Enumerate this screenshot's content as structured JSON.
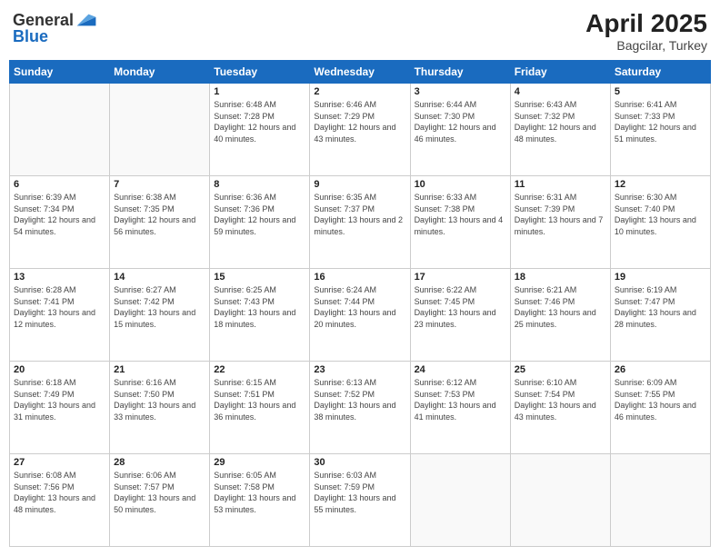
{
  "header": {
    "logo_line1": "General",
    "logo_line2": "Blue",
    "title": "April 2025",
    "subtitle": "Bagcilar, Turkey"
  },
  "weekdays": [
    "Sunday",
    "Monday",
    "Tuesday",
    "Wednesday",
    "Thursday",
    "Friday",
    "Saturday"
  ],
  "weeks": [
    [
      {
        "day": "",
        "info": ""
      },
      {
        "day": "",
        "info": ""
      },
      {
        "day": "1",
        "info": "Sunrise: 6:48 AM\nSunset: 7:28 PM\nDaylight: 12 hours and 40 minutes."
      },
      {
        "day": "2",
        "info": "Sunrise: 6:46 AM\nSunset: 7:29 PM\nDaylight: 12 hours and 43 minutes."
      },
      {
        "day": "3",
        "info": "Sunrise: 6:44 AM\nSunset: 7:30 PM\nDaylight: 12 hours and 46 minutes."
      },
      {
        "day": "4",
        "info": "Sunrise: 6:43 AM\nSunset: 7:32 PM\nDaylight: 12 hours and 48 minutes."
      },
      {
        "day": "5",
        "info": "Sunrise: 6:41 AM\nSunset: 7:33 PM\nDaylight: 12 hours and 51 minutes."
      }
    ],
    [
      {
        "day": "6",
        "info": "Sunrise: 6:39 AM\nSunset: 7:34 PM\nDaylight: 12 hours and 54 minutes."
      },
      {
        "day": "7",
        "info": "Sunrise: 6:38 AM\nSunset: 7:35 PM\nDaylight: 12 hours and 56 minutes."
      },
      {
        "day": "8",
        "info": "Sunrise: 6:36 AM\nSunset: 7:36 PM\nDaylight: 12 hours and 59 minutes."
      },
      {
        "day": "9",
        "info": "Sunrise: 6:35 AM\nSunset: 7:37 PM\nDaylight: 13 hours and 2 minutes."
      },
      {
        "day": "10",
        "info": "Sunrise: 6:33 AM\nSunset: 7:38 PM\nDaylight: 13 hours and 4 minutes."
      },
      {
        "day": "11",
        "info": "Sunrise: 6:31 AM\nSunset: 7:39 PM\nDaylight: 13 hours and 7 minutes."
      },
      {
        "day": "12",
        "info": "Sunrise: 6:30 AM\nSunset: 7:40 PM\nDaylight: 13 hours and 10 minutes."
      }
    ],
    [
      {
        "day": "13",
        "info": "Sunrise: 6:28 AM\nSunset: 7:41 PM\nDaylight: 13 hours and 12 minutes."
      },
      {
        "day": "14",
        "info": "Sunrise: 6:27 AM\nSunset: 7:42 PM\nDaylight: 13 hours and 15 minutes."
      },
      {
        "day": "15",
        "info": "Sunrise: 6:25 AM\nSunset: 7:43 PM\nDaylight: 13 hours and 18 minutes."
      },
      {
        "day": "16",
        "info": "Sunrise: 6:24 AM\nSunset: 7:44 PM\nDaylight: 13 hours and 20 minutes."
      },
      {
        "day": "17",
        "info": "Sunrise: 6:22 AM\nSunset: 7:45 PM\nDaylight: 13 hours and 23 minutes."
      },
      {
        "day": "18",
        "info": "Sunrise: 6:21 AM\nSunset: 7:46 PM\nDaylight: 13 hours and 25 minutes."
      },
      {
        "day": "19",
        "info": "Sunrise: 6:19 AM\nSunset: 7:47 PM\nDaylight: 13 hours and 28 minutes."
      }
    ],
    [
      {
        "day": "20",
        "info": "Sunrise: 6:18 AM\nSunset: 7:49 PM\nDaylight: 13 hours and 31 minutes."
      },
      {
        "day": "21",
        "info": "Sunrise: 6:16 AM\nSunset: 7:50 PM\nDaylight: 13 hours and 33 minutes."
      },
      {
        "day": "22",
        "info": "Sunrise: 6:15 AM\nSunset: 7:51 PM\nDaylight: 13 hours and 36 minutes."
      },
      {
        "day": "23",
        "info": "Sunrise: 6:13 AM\nSunset: 7:52 PM\nDaylight: 13 hours and 38 minutes."
      },
      {
        "day": "24",
        "info": "Sunrise: 6:12 AM\nSunset: 7:53 PM\nDaylight: 13 hours and 41 minutes."
      },
      {
        "day": "25",
        "info": "Sunrise: 6:10 AM\nSunset: 7:54 PM\nDaylight: 13 hours and 43 minutes."
      },
      {
        "day": "26",
        "info": "Sunrise: 6:09 AM\nSunset: 7:55 PM\nDaylight: 13 hours and 46 minutes."
      }
    ],
    [
      {
        "day": "27",
        "info": "Sunrise: 6:08 AM\nSunset: 7:56 PM\nDaylight: 13 hours and 48 minutes."
      },
      {
        "day": "28",
        "info": "Sunrise: 6:06 AM\nSunset: 7:57 PM\nDaylight: 13 hours and 50 minutes."
      },
      {
        "day": "29",
        "info": "Sunrise: 6:05 AM\nSunset: 7:58 PM\nDaylight: 13 hours and 53 minutes."
      },
      {
        "day": "30",
        "info": "Sunrise: 6:03 AM\nSunset: 7:59 PM\nDaylight: 13 hours and 55 minutes."
      },
      {
        "day": "",
        "info": ""
      },
      {
        "day": "",
        "info": ""
      },
      {
        "day": "",
        "info": ""
      }
    ]
  ]
}
